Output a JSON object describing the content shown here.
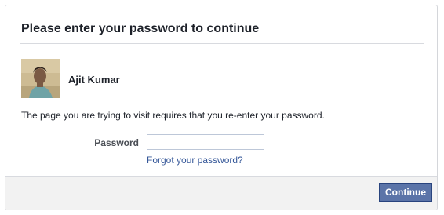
{
  "dialog": {
    "title": "Please enter your password to continue"
  },
  "user": {
    "name": "Ajit Kumar",
    "avatar_icon": "profile-photo"
  },
  "message": "The page you are trying to visit requires that you re-enter your password.",
  "form": {
    "password_label": "Password",
    "password_value": "",
    "forgot_link": "Forgot your password?"
  },
  "footer": {
    "continue_label": "Continue"
  },
  "colors": {
    "link": "#365899",
    "button_bg": "#5b74a8",
    "footer_bg": "#f2f2f2"
  }
}
